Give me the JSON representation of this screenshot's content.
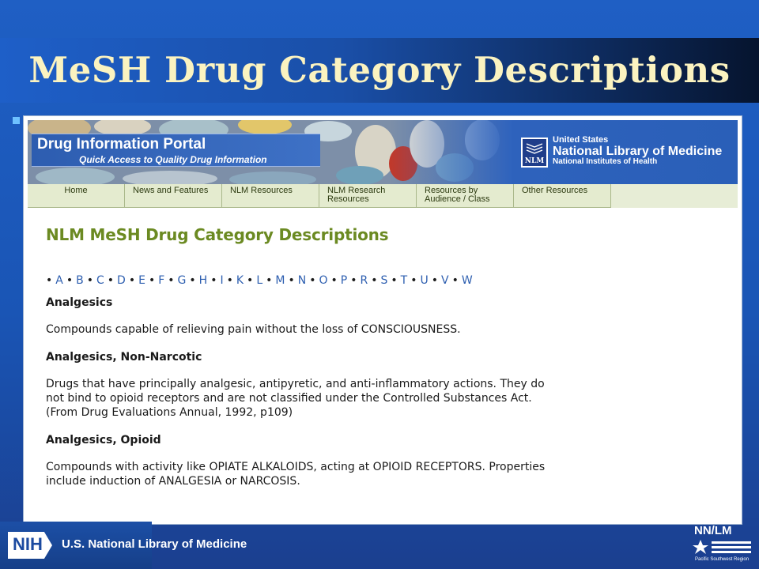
{
  "slide": {
    "title": "MeSH Drug Category Descriptions"
  },
  "portal": {
    "name": "Drug Information Portal",
    "tagline": "Quick Access to Quality Drug Information",
    "nlm_logo_text": "NLM",
    "nlm_country": "United States",
    "nlm_name": "National Library of Medicine",
    "nlm_parent": "National Institutes of Health"
  },
  "nav": {
    "items": [
      {
        "label": "Home"
      },
      {
        "label": "News and Features"
      },
      {
        "label": "NLM Resources"
      },
      {
        "label": "NLM Research Resources"
      },
      {
        "label": "Resources by Audience / Class"
      },
      {
        "label": "Other Resources"
      }
    ]
  },
  "content": {
    "heading": "NLM MeSH Drug Category Descriptions",
    "alphabet": [
      "A",
      "B",
      "C",
      "D",
      "E",
      "F",
      "G",
      "H",
      "I",
      "K",
      "L",
      "M",
      "N",
      "O",
      "P",
      "R",
      "S",
      "T",
      "U",
      "V",
      "W"
    ],
    "entries": [
      {
        "term": "Analgesics",
        "description": "Compounds capable of relieving pain without the loss of CONSCIOUSNESS."
      },
      {
        "term": "Analgesics, Non-Narcotic",
        "description": "Drugs that have principally analgesic, antipyretic, and anti-inflammatory actions.  They do not bind to opioid receptors and are not classified under the Controlled Substances Act.  (From Drug Evaluations Annual, 1992, p109)"
      },
      {
        "term": "Analgesics, Opioid",
        "description": "Compounds with activity like OPIATE ALKALOIDS, acting at OPIOID RECEPTORS.  Properties include induction of ANALGESIA or NARCOSIS."
      }
    ]
  },
  "footer": {
    "nih_badge": "NIH",
    "nih_text": "U.S. National Library of Medicine",
    "nnlm_text": "NN/LM",
    "nnlm_region": "Pacific Southwest Region"
  },
  "colors": {
    "slide_background": "#1f5fc4",
    "title_color": "#fbf3c0",
    "heading_color": "#6b8a22",
    "link_color": "#2e5fb0",
    "nav_background": "#e4ebcf"
  }
}
